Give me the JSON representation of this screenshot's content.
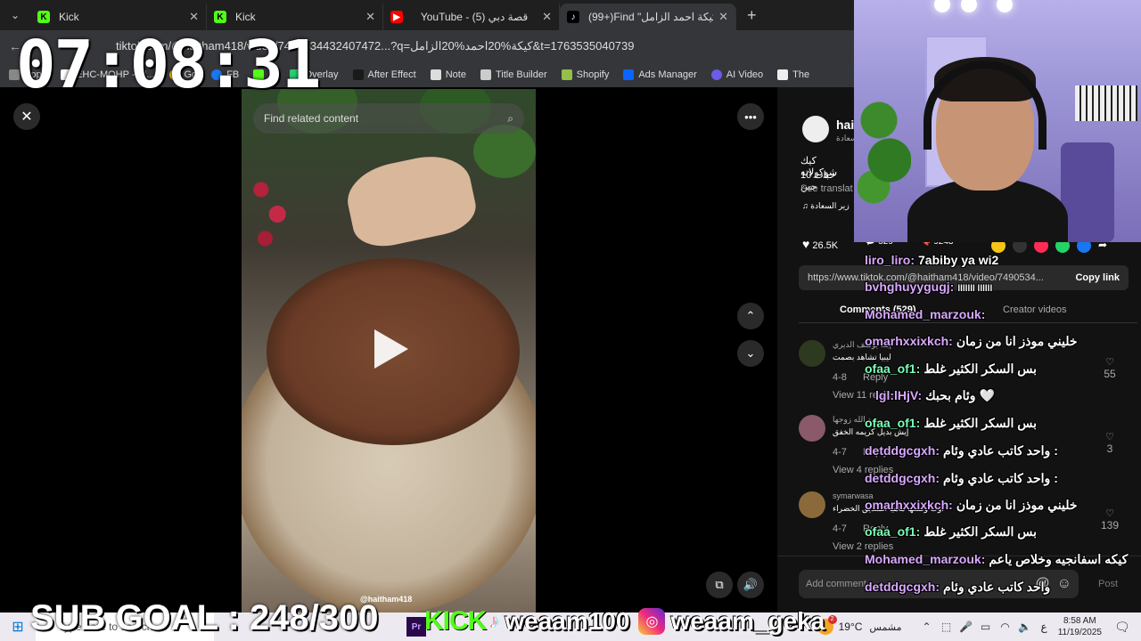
{
  "browser": {
    "tabs": [
      {
        "title": "Kick",
        "favicon": "kick-icon",
        "color": "#53fc18"
      },
      {
        "title": "Kick",
        "favicon": "kick-icon",
        "color": "#53fc18"
      },
      {
        "title": "YouTube - (5) قصة دبي",
        "favicon": "youtube-icon",
        "color": "#ff0000"
      },
      {
        "title": "(99+)Find \"كيكة احمد الزامل\" on T",
        "favicon": "tiktok-icon",
        "color": "#ffffff"
      }
    ],
    "url": "tiktok.com/@haitham418/video/7490534432407472...?q=كيكة%20احمد%20الزامل&t=1763535040739",
    "bookmarks": [
      "Apps",
      "EHC-MOHP - El...",
      "Gg",
      "FB",
      "K",
      "Overlay",
      "After Effect",
      "Note",
      "Title Builder",
      "Shopify",
      "Ads Manager",
      "AI Video",
      "The"
    ]
  },
  "overlay_clock": "07:08:31",
  "player": {
    "search_placeholder": "Find related content",
    "watermark": "@haitham418"
  },
  "panel": {
    "author_short": "hai",
    "author_sub": "السعادة",
    "desc_line1": "كيك شوكولاته",
    "desc_line2": "10 حبات جبن",
    "see_translation": "See translat",
    "music": "زير السعادة",
    "likes": "26.5K",
    "comments_count_icon": "529",
    "saves": "9243",
    "link": "https://www.tiktok.com/@haitham418/video/7490534...",
    "copy_link": "Copy link",
    "tab_comments": "Comments (529)",
    "tab_creator": "Creator videos",
    "comments": [
      {
        "name": "إبنة يوسف الديري",
        "text": "ليبيا تشاهد بصمت",
        "date": "4-8",
        "reply": "Reply",
        "likes": "55",
        "view_replies": "View 11 replies"
      },
      {
        "name": "عبد الله زوجها",
        "text": "إيش بديل كريمه الخفق",
        "date": "4-7",
        "reply": "Reply",
        "likes": "3",
        "view_replies": "View 4 replies"
      },
      {
        "name": "symarwasa",
        "text": "اوث وضعها ماهيا السديق الخضراء",
        "date": "4-7",
        "reply": "Reply",
        "likes": "139",
        "view_replies": "View 2 replies"
      }
    ],
    "add_comment": "Add comment...",
    "post": "Post"
  },
  "chat": [
    {
      "user": "liro_liro:",
      "msg": "7abiby ya wi2",
      "color": "#d9a9ff"
    },
    {
      "user": "bvhghuyygugj:",
      "msg": "lllllll llllll",
      "color": "#d9a9ff"
    },
    {
      "user": "Mohamed_marzouk:",
      "msg": "",
      "color": "#d9a9ff"
    },
    {
      "user": "omarhxxixkch:",
      "msg": "خليني موذز انا من زمان",
      "color": "#d9a9ff"
    },
    {
      "user": "ofaa_of1:",
      "msg": "بس السكر الكثير غلط",
      "color": "#7dffb8"
    },
    {
      "user": "lgl:lHjV:",
      "msg": "وئام بحبك 🤍",
      "color": "#d9a9ff"
    },
    {
      "user": "ofaa_of1:",
      "msg": "بس السكر الكثير غلط",
      "color": "#7dffb8"
    },
    {
      "user": "detddgcgxh:",
      "msg": "واحد كاتب عادي وئام :",
      "color": "#d9a9ff"
    },
    {
      "user": "detddgcgxh:",
      "msg": "واحد كاتب عادي وئام :",
      "color": "#d9a9ff"
    },
    {
      "user": "omarhxxixkch:",
      "msg": "خليني موذز انا من زمان",
      "color": "#d9a9ff"
    },
    {
      "user": "ofaa_of1:",
      "msg": "بس السكر الكثير غلط",
      "color": "#7dffb8"
    },
    {
      "user": "Mohamed_marzouk:",
      "msg": "كيكه اسفانجيه وخلاص ياعم",
      "color": "#d9a9ff"
    },
    {
      "user": "detddgcgxh:",
      "msg": "واحد كاتب عادي وئام",
      "color": "#d9a9ff"
    }
  ],
  "sub_goal": "SUB GOAL : 248/300",
  "socials": {
    "kick_label": "KICK",
    "kick_name": "weaam100",
    "instagram_name": "weaam_geka"
  },
  "taskbar": {
    "search": "Type here to search",
    "weather_temp": "19°C",
    "weather_text": "مشمس",
    "lang": "ع",
    "time": "8:58 AM",
    "date": "11/19/2025",
    "notif": "2"
  }
}
